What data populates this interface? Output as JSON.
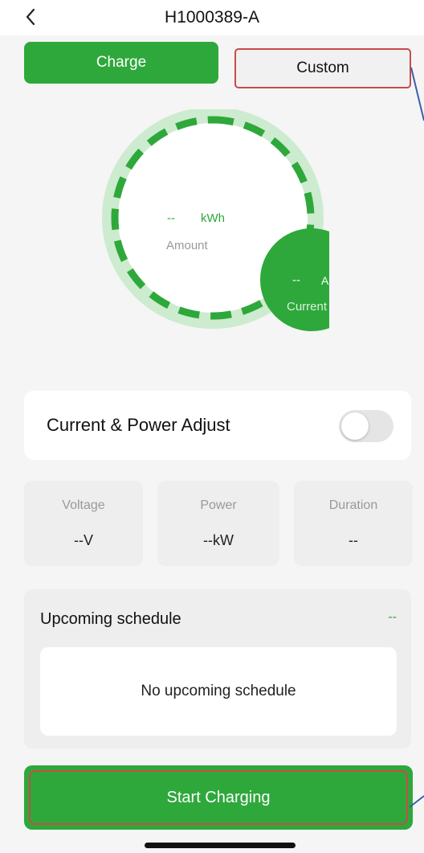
{
  "header": {
    "title": "H1000389-A",
    "back_icon": "chevron-left-icon"
  },
  "tabs": [
    {
      "label": "Charge",
      "active": true
    },
    {
      "label": "Custom",
      "active": false
    }
  ],
  "gauge": {
    "amount_value": "--",
    "amount_unit": "kWh",
    "amount_label": "Amount",
    "current_value": "--",
    "current_unit": "A",
    "current_label": "Current"
  },
  "adjust": {
    "label": "Current & Power Adjust",
    "enabled": false
  },
  "metrics": [
    {
      "label": "Voltage",
      "value": "--V"
    },
    {
      "label": "Power",
      "value": "--kW"
    },
    {
      "label": "Duration",
      "value": "--"
    }
  ],
  "schedule": {
    "title": "Upcoming schedule",
    "more": "--",
    "empty_text": "No upcoming schedule"
  },
  "actions": {
    "start_label": "Start Charging"
  },
  "colors": {
    "accent": "#2ea83b",
    "highlight": "#c94b4b",
    "annotation": "#3b5fa8"
  }
}
